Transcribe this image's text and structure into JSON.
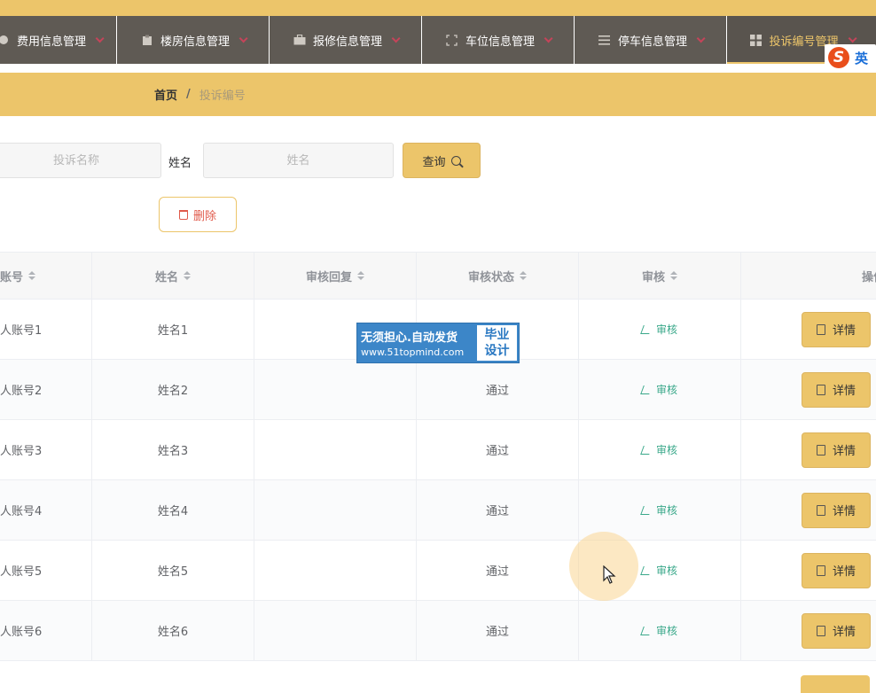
{
  "nav": {
    "items": [
      {
        "label": "费用信息管理",
        "icon": "circle-icon"
      },
      {
        "label": "楼房信息管理",
        "icon": "clipboard-icon"
      },
      {
        "label": "报修信息管理",
        "icon": "briefcase-icon"
      },
      {
        "label": "车位信息管理",
        "icon": "frame-icon"
      },
      {
        "label": "停车信息管理",
        "icon": "list-icon"
      },
      {
        "label": "投诉编号管理",
        "icon": "grid-icon",
        "active": true
      }
    ],
    "accent_color": "#ecc56a",
    "background_color": "#5f5a54"
  },
  "lang_badge": {
    "logo": "S",
    "label": "英"
  },
  "breadcrumb": {
    "home": "首页",
    "separator": "/",
    "current": "投诉编号"
  },
  "search": {
    "name_placeholder": "投诉名称",
    "person_label": "姓名",
    "person_placeholder": "姓名",
    "query_label": "查询"
  },
  "actions": {
    "delete_label": "删除"
  },
  "table": {
    "columns": [
      "账号",
      "姓名",
      "审核回复",
      "审核状态",
      "审核",
      "操作"
    ],
    "audit_label": "审核",
    "detail_label": "详情",
    "rows": [
      {
        "account": "人账号1",
        "name": "姓名1",
        "reply": "",
        "status": ""
      },
      {
        "account": "人账号2",
        "name": "姓名2",
        "reply": "",
        "status": "通过"
      },
      {
        "account": "人账号3",
        "name": "姓名3",
        "reply": "",
        "status": "通过"
      },
      {
        "account": "人账号4",
        "name": "姓名4",
        "reply": "",
        "status": "通过"
      },
      {
        "account": "人账号5",
        "name": "姓名5",
        "reply": "",
        "status": "通过"
      },
      {
        "account": "人账号6",
        "name": "姓名6",
        "reply": "",
        "status": "通过"
      }
    ]
  },
  "watermark": {
    "line1": "无须担心.自动发货",
    "line2": "www.51topmind.com",
    "side1": "毕业",
    "side2": "设计"
  }
}
